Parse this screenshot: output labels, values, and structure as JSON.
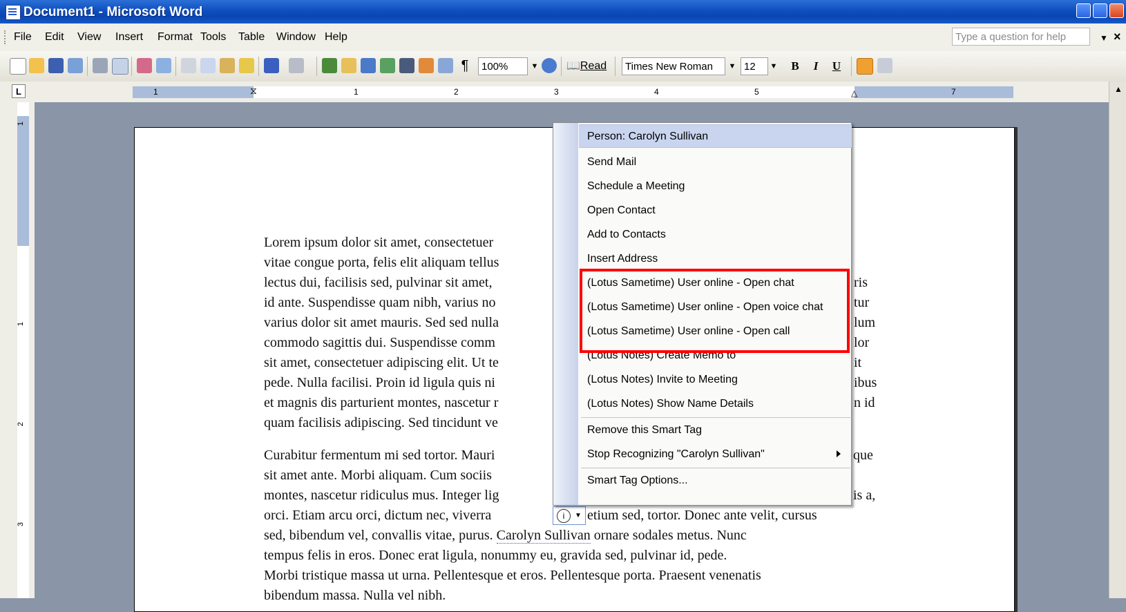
{
  "window": {
    "title": "Document1 - Microsoft Word"
  },
  "menubar": {
    "items": [
      "File",
      "Edit",
      "View",
      "Insert",
      "Format",
      "Tools",
      "Table",
      "Window",
      "Help"
    ],
    "ask_placeholder": "Type a question for help"
  },
  "toolbar": {
    "zoom": "100%",
    "read_label": "Read",
    "font": "Times New Roman",
    "font_size": "12",
    "bold": "B",
    "italic": "I",
    "underline": "U"
  },
  "ruler": {
    "h_numbers": [
      "1",
      "1",
      "2",
      "3",
      "4",
      "5",
      "7"
    ],
    "v_numbers": [
      "1",
      "1",
      "2",
      "3"
    ]
  },
  "document": {
    "para1": [
      "Lorem ipsum dolor sit amet, consectetuer",
      "vitae congue porta, felis elit aliquam tellus",
      "lectus dui, facilisis sed, pulvinar sit amet,",
      "id ante. Suspendisse quam nibh, varius no",
      "varius dolor sit amet mauris. Sed sed nulla",
      "commodo sagittis dui. Suspendisse comm",
      "sit amet, consectetuer adipiscing elit. Ut te",
      "pede. Nulla facilisi. Proin id ligula quis ni",
      "et magnis dis parturient montes, nascetur r",
      "quam facilisis adipiscing. Sed tincidunt ve"
    ],
    "para1_right": [
      "ris",
      "tur",
      "lum",
      "lor",
      "it",
      "ibus",
      "n id"
    ],
    "para2": [
      "Curabitur fermentum mi sed tortor. Mauri",
      "sit amet ante. Morbi aliquam. Cum sociis",
      "montes, nascetur ridiculus mus. Integer lig",
      "orci. Etiam arcu orci, dictum nec, viverra"
    ],
    "para2_right": [
      "que",
      "is a,"
    ],
    "line_etium": "etium sed, tortor. Donec ante velit, cursus",
    "line_carolyn_pre": "sed, bibendum vel, convallis vitae, purus. ",
    "line_carolyn_name": "Carolyn Sullivan",
    "line_carolyn_post": " ornare sodales metus. Nunc",
    "line_tempus": "tempus felis in eros. Donec erat ligula, nonummy eu, gravida sed, pulvinar id, pede.",
    "line_morbi": "Morbi tristique massa ut urna. Pellentesque et eros. Pellentesque porta. Praesent venenatis",
    "line_last": "bibendum massa. Nulla vel nibh."
  },
  "smart_tag_menu": {
    "header": "Person: Carolyn Sullivan",
    "items": [
      "Send Mail",
      "Schedule a Meeting",
      "Open Contact",
      "Add to Contacts",
      "Insert Address",
      "(Lotus Sametime) User online - Open chat",
      "(Lotus Sametime) User online - Open voice chat",
      "(Lotus Sametime) User online - Open call",
      "(Lotus Notes) Create Memo to",
      "(Lotus Notes) Invite to Meeting",
      "(Lotus Notes) Show Name Details"
    ],
    "remove": "Remove this Smart Tag",
    "stop": "Stop Recognizing \"Carolyn Sullivan\"",
    "options": "Smart Tag Options..."
  }
}
